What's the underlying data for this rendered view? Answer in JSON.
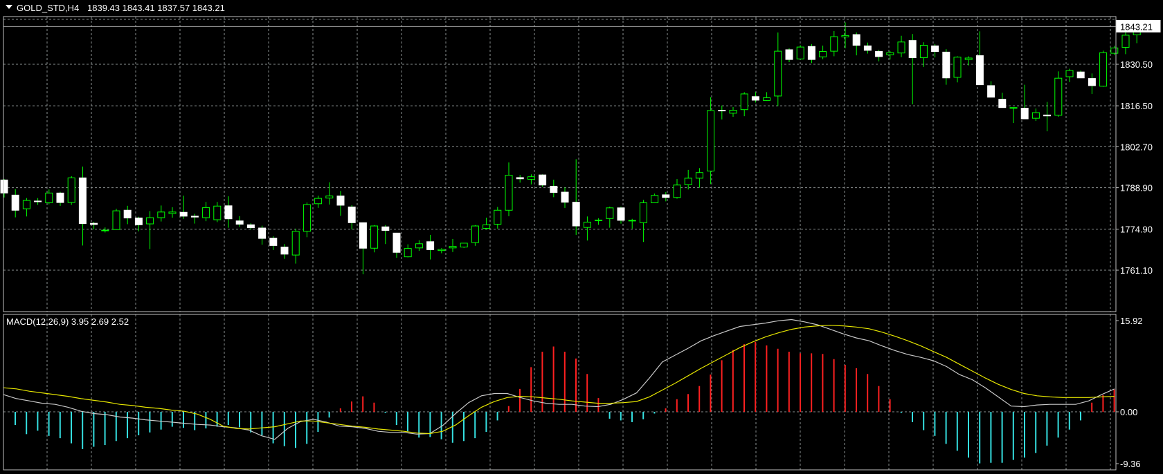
{
  "chart_data": [
    {
      "type": "candlestick",
      "title": "GOLD_STD,H4",
      "ohlc_label": "1839.43 1843.41 1837.57 1843.21",
      "current_price": 1843.21,
      "current_price_label": "1843.21",
      "y_ticks": [
        "1830.50",
        "1816.50",
        "1802.70",
        "1788.90",
        "1774.90",
        "1761.10"
      ],
      "ylim": [
        1756.0,
        1850.0
      ],
      "grid": true,
      "colors": {
        "up": "#000000",
        "down": "#ffffff",
        "wick": "#00ff00",
        "grid": "#9aa0a0",
        "background": "#000000"
      },
      "candles": [
        [
          1791.5,
          1791.8,
          1785.6,
          1787.1
        ],
        [
          1786.4,
          1788.4,
          1778.9,
          1781.3
        ],
        [
          1781.8,
          1785.4,
          1779.2,
          1784.6
        ],
        [
          1784.4,
          1785.4,
          1783.1,
          1784.2
        ],
        [
          1783.8,
          1788.3,
          1783.3,
          1787.1
        ],
        [
          1787.1,
          1787.5,
          1782.8,
          1783.9
        ],
        [
          1783.9,
          1792.8,
          1783.1,
          1792.2
        ],
        [
          1792.2,
          1796.0,
          1769.4,
          1776.8
        ],
        [
          1776.9,
          1777.4,
          1774.8,
          1776.5
        ],
        [
          1774.4,
          1775.5,
          1773.8,
          1774.6
        ],
        [
          1774.8,
          1781.8,
          1774.7,
          1781.1
        ],
        [
          1781.3,
          1782.8,
          1776.6,
          1778.7
        ],
        [
          1778.7,
          1779.1,
          1774.2,
          1776.4
        ],
        [
          1776.7,
          1781.0,
          1768.2,
          1778.8
        ],
        [
          1778.8,
          1782.9,
          1777.5,
          1780.7
        ],
        [
          1780.2,
          1782.3,
          1778.8,
          1780.7
        ],
        [
          1780.6,
          1786.2,
          1778.4,
          1779.3
        ],
        [
          1779.3,
          1780.1,
          1776.8,
          1779.0
        ],
        [
          1778.8,
          1784.1,
          1777.6,
          1782.2
        ],
        [
          1778.1,
          1784.1,
          1777.3,
          1782.7
        ],
        [
          1782.8,
          1786.0,
          1775.4,
          1778.4
        ],
        [
          1777.7,
          1779.3,
          1775.7,
          1776.6
        ],
        [
          1776.4,
          1776.9,
          1774.8,
          1775.4
        ],
        [
          1775.3,
          1776.1,
          1769.7,
          1771.8
        ],
        [
          1771.9,
          1772.5,
          1767.9,
          1769.4
        ],
        [
          1768.9,
          1769.9,
          1764.9,
          1766.5
        ],
        [
          1766.2,
          1775.1,
          1763.3,
          1774.2
        ],
        [
          1774.2,
          1783.9,
          1772.2,
          1783.2
        ],
        [
          1783.5,
          1786.2,
          1782.1,
          1785.3
        ],
        [
          1785.4,
          1790.7,
          1783.2,
          1786.1
        ],
        [
          1786.1,
          1787.8,
          1779.4,
          1783.0
        ],
        [
          1782.4,
          1783.0,
          1774.8,
          1777.1
        ],
        [
          1777.1,
          1777.2,
          1759.7,
          1768.5
        ],
        [
          1768.5,
          1776.3,
          1767.1,
          1776.0
        ],
        [
          1775.7,
          1776.3,
          1769.9,
          1774.5
        ],
        [
          1773.6,
          1773.7,
          1765.3,
          1767.1
        ],
        [
          1765.6,
          1769.8,
          1765.4,
          1768.4
        ],
        [
          1768.6,
          1771.2,
          1767.6,
          1770.0
        ],
        [
          1770.7,
          1773.0,
          1764.7,
          1768.0
        ],
        [
          1767.7,
          1768.5,
          1766.8,
          1768.1
        ],
        [
          1768.6,
          1771.6,
          1767.2,
          1769.1
        ],
        [
          1768.9,
          1770.3,
          1768.6,
          1770.2
        ],
        [
          1770.4,
          1776.3,
          1769.3,
          1776.0
        ],
        [
          1775.2,
          1778.8,
          1774.8,
          1776.4
        ],
        [
          1776.6,
          1782.4,
          1775.1,
          1781.3
        ],
        [
          1781.3,
          1797.4,
          1779.3,
          1793.1
        ],
        [
          1792.3,
          1793.2,
          1790.6,
          1791.9
        ],
        [
          1791.7,
          1793.4,
          1790.0,
          1792.6
        ],
        [
          1793.2,
          1793.4,
          1789.2,
          1789.8
        ],
        [
          1789.4,
          1791.6,
          1785.7,
          1787.3
        ],
        [
          1787.4,
          1789.0,
          1782.1,
          1784.0
        ],
        [
          1784.0,
          1798.5,
          1773.0,
          1776.0
        ],
        [
          1775.5,
          1779.2,
          1771.1,
          1777.3
        ],
        [
          1777.9,
          1778.6,
          1776.4,
          1778.0
        ],
        [
          1778.5,
          1782.5,
          1775.4,
          1782.1
        ],
        [
          1782.1,
          1782.5,
          1776.8,
          1777.9
        ],
        [
          1777.9,
          1778.4,
          1775.1,
          1777.9
        ],
        [
          1777.1,
          1784.8,
          1770.6,
          1783.8
        ],
        [
          1783.8,
          1786.9,
          1784.7,
          1786.3
        ],
        [
          1786.5,
          1787.4,
          1784.3,
          1785.6
        ],
        [
          1785.6,
          1791.8,
          1785.2,
          1789.8
        ],
        [
          1789.9,
          1794.9,
          1788.3,
          1792.1
        ],
        [
          1792.1,
          1795.5,
          1788.9,
          1794.0
        ],
        [
          1794.5,
          1819.4,
          1790.1,
          1814.9
        ],
        [
          1815.0,
          1816.6,
          1811.9,
          1814.8
        ],
        [
          1814.0,
          1816.1,
          1812.8,
          1815.0
        ],
        [
          1815.2,
          1821.1,
          1813.0,
          1820.5
        ],
        [
          1819.6,
          1821.1,
          1817.6,
          1818.4
        ],
        [
          1818.3,
          1821.1,
          1818.2,
          1819.2
        ],
        [
          1819.8,
          1841.2,
          1816.4,
          1834.9
        ],
        [
          1835.4,
          1835.9,
          1831.2,
          1832.1
        ],
        [
          1832.3,
          1836.9,
          1832.2,
          1836.3
        ],
        [
          1836.5,
          1837.3,
          1830.9,
          1832.1
        ],
        [
          1833.0,
          1836.8,
          1832.2,
          1834.8
        ],
        [
          1834.9,
          1841.7,
          1833.2,
          1839.8
        ],
        [
          1839.7,
          1844.6,
          1835.9,
          1840.2
        ],
        [
          1840.5,
          1841.2,
          1833.5,
          1836.9
        ],
        [
          1836.7,
          1837.8,
          1834.1,
          1835.2
        ],
        [
          1834.8,
          1835.4,
          1831.5,
          1833.1
        ],
        [
          1833.7,
          1834.9,
          1832.1,
          1834.4
        ],
        [
          1834.3,
          1840.1,
          1832.9,
          1838.0
        ],
        [
          1838.5,
          1840.7,
          1817.0,
          1832.7
        ],
        [
          1832.7,
          1837.9,
          1829.6,
          1836.9
        ],
        [
          1836.7,
          1837.3,
          1832.8,
          1834.8
        ],
        [
          1834.6,
          1835.6,
          1823.6,
          1825.9
        ],
        [
          1826.1,
          1833.2,
          1824.4,
          1832.9
        ],
        [
          1832.1,
          1833.2,
          1830.1,
          1832.6
        ],
        [
          1833.4,
          1841.6,
          1823.5,
          1823.6
        ],
        [
          1823.3,
          1824.8,
          1821.1,
          1819.4
        ],
        [
          1818.7,
          1820.9,
          1817.3,
          1815.9
        ],
        [
          1815.9,
          1815.9,
          1810.7,
          1815.9
        ],
        [
          1815.7,
          1823.6,
          1812.7,
          1812.1
        ],
        [
          1812.3,
          1815.6,
          1811.4,
          1814.2
        ],
        [
          1813.4,
          1817.8,
          1807.9,
          1813.1
        ],
        [
          1813.3,
          1828.1,
          1812.8,
          1825.8
        ],
        [
          1826.3,
          1829.0,
          1824.5,
          1828.4
        ],
        [
          1827.9,
          1828.4,
          1826.5,
          1825.9
        ],
        [
          1825.7,
          1827.4,
          1820.5,
          1823.3
        ],
        [
          1823.1,
          1835.1,
          1822.9,
          1834.4
        ],
        [
          1834.2,
          1836.7,
          1833.6,
          1836.0
        ],
        [
          1836.2,
          1842.2,
          1833.9,
          1840.3
        ],
        [
          1840.4,
          1843.4,
          1837.6,
          1843.2
        ]
      ]
    },
    {
      "type": "macd",
      "label": "MACD(12,26,9) 3.95 2.69 2.52",
      "y_ticks": [
        "15.92",
        "0.00",
        "-9.36"
      ],
      "ylim": [
        -9.36,
        15.92
      ],
      "colors": {
        "hist_pos": "#ff2020",
        "hist_neg": "#35dfe0",
        "macd_line": "#c8c8c8",
        "signal_line": "#e6e600"
      },
      "histogram": [
        -2.3,
        -3.9,
        -3.3,
        -4.2,
        -4.6,
        -5.5,
        -6.5,
        -6.1,
        -5.8,
        -5.1,
        -4.6,
        -4.1,
        -3.6,
        -3.1,
        -2.6,
        -2.8,
        -3.2,
        -2.9,
        -2.6,
        -2.3,
        -2.7,
        -3.6,
        -4.1,
        -5.5,
        -6.0,
        -6.3,
        -5.6,
        -3.5,
        -1.0,
        0.6,
        1.8,
        2.7,
        1.6,
        -0.2,
        -2.3,
        -3.4,
        -4.5,
        -4.4,
        -4.8,
        -5.4,
        -5.1,
        -4.6,
        -3.5,
        -1.5,
        1.0,
        4.0,
        7.8,
        10.5,
        11.4,
        10.5,
        9.3,
        6.6,
        2.4,
        -1.2,
        -1.5,
        -1.8,
        -1.3,
        -0.3,
        0.6,
        2.2,
        3.1,
        4.5,
        6.5,
        9.0,
        10.8,
        11.8,
        12.2,
        11.6,
        11.0,
        10.5,
        10.2,
        10.2,
        10.1,
        9.2,
        8.2,
        7.6,
        6.6,
        4.5,
        2.2,
        -0.2,
        -1.8,
        -3.2,
        -4.2,
        -5.6,
        -6.8,
        -8.0,
        -9.0,
        -8.9,
        -8.9,
        -8.4,
        -8.0,
        -7.2,
        -5.9,
        -4.5,
        -3.1,
        -1.5,
        1.6,
        2.9,
        3.9
      ],
      "macd": [
        3.0,
        2.3,
        1.9,
        1.5,
        1.3,
        0.8,
        0.1,
        -0.3,
        -0.5,
        -0.9,
        -1.1,
        -1.4,
        -1.6,
        -1.8,
        -2.0,
        -2.2,
        -2.3,
        -2.6,
        -2.8,
        -3.2,
        -4.2,
        -4.8,
        -2.9,
        -1.7,
        -1.3,
        -1.8,
        -2.5,
        -2.6,
        -2.9,
        -3.4,
        -3.6,
        -3.6,
        -3.9,
        -3.8,
        -2.4,
        -0.3,
        1.6,
        2.8,
        3.2,
        3.2,
        2.5,
        1.9,
        1.5,
        1.3,
        1.3,
        1.0,
        0.9,
        1.3,
        2.2,
        3.3,
        5.9,
        8.7,
        9.9,
        11.1,
        12.4,
        13.3,
        14.1,
        14.9,
        15.2,
        15.5,
        15.9,
        16.1,
        15.7,
        15.2,
        14.4,
        13.6,
        12.9,
        12.4,
        11.5,
        10.7,
        10.0,
        9.5,
        8.9,
        7.9,
        6.5,
        5.6,
        4.2,
        2.6,
        1.0,
        0.9,
        1.2,
        1.3,
        1.3,
        1.3,
        1.9,
        3.0,
        4.0
      ],
      "signal": [
        4.2,
        4.0,
        3.6,
        3.3,
        3.0,
        2.7,
        2.3,
        2.0,
        1.7,
        1.3,
        1.1,
        0.8,
        0.6,
        0.3,
        0.1,
        -0.4,
        -1.3,
        -2.5,
        -2.9,
        -3.0,
        -2.8,
        -2.6,
        -2.1,
        -1.6,
        -1.6,
        -1.9,
        -2.2,
        -2.5,
        -2.7,
        -3.0,
        -3.2,
        -3.4,
        -3.7,
        -3.8,
        -3.4,
        -2.3,
        -0.7,
        0.8,
        1.8,
        2.5,
        2.7,
        2.6,
        2.4,
        2.2,
        1.9,
        1.7,
        1.5,
        1.5,
        1.6,
        1.8,
        2.6,
        3.8,
        5.0,
        6.3,
        7.6,
        8.8,
        10.0,
        11.2,
        12.2,
        13.1,
        13.8,
        14.4,
        14.8,
        15.0,
        15.1,
        15.0,
        14.8,
        14.5,
        13.9,
        13.2,
        12.4,
        11.5,
        10.5,
        9.5,
        8.3,
        7.1,
        5.9,
        4.8,
        3.9,
        3.2,
        2.8,
        2.6,
        2.5,
        2.5,
        2.5,
        2.6,
        2.7
      ]
    }
  ]
}
